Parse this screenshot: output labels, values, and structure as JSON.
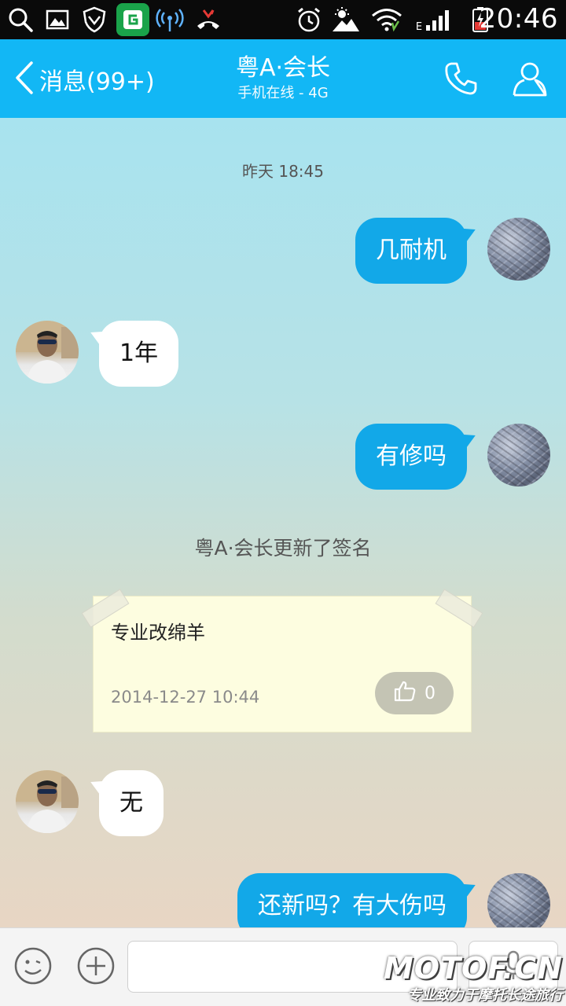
{
  "status_bar": {
    "time": "20:46",
    "network_type": "E",
    "icons": [
      "search-icon",
      "image-icon",
      "shield-icon",
      "app-badge-icon",
      "signal-broadcast-icon",
      "missed-call-icon",
      "alarm-icon",
      "weather-icon",
      "wifi-icon",
      "cell-signal-icon",
      "battery-icon"
    ],
    "colors": {
      "background": "#0a0a0a",
      "app_badge": "#1aa34a"
    }
  },
  "header": {
    "back_label": "消息(99+)",
    "title": "粤A·会长",
    "subtitle": "手机在线 - 4G",
    "icons": [
      "back-chevron-icon",
      "phone-icon",
      "profile-icon"
    ],
    "colors": {
      "background": "#12b7f5"
    }
  },
  "chat": {
    "timestamp": "昨天 18:45",
    "messages": [
      {
        "sender": "me",
        "text": "几耐机"
      },
      {
        "sender": "them",
        "text": "1年"
      },
      {
        "sender": "me",
        "text": "有修吗"
      },
      {
        "sender": "them",
        "text": "无"
      },
      {
        "sender": "me",
        "text": "还新吗？有大伤吗"
      }
    ],
    "system_message": "粤A·会长更新了签名",
    "signature_card": {
      "text": "专业改绵羊",
      "date": "2014-12-27 10:44",
      "like_count": "0"
    },
    "colors": {
      "my_bubble": "#12a8e8",
      "their_bubble": "#ffffff",
      "note_background": "#fdfde0"
    }
  },
  "input_bar": {
    "input_value": "",
    "icons": [
      "emoji-icon",
      "plus-icon",
      "microphone-icon"
    ]
  },
  "watermark": {
    "brand": "MOTOF.CN",
    "tagline": "专业致力于摩托长途旅行"
  }
}
